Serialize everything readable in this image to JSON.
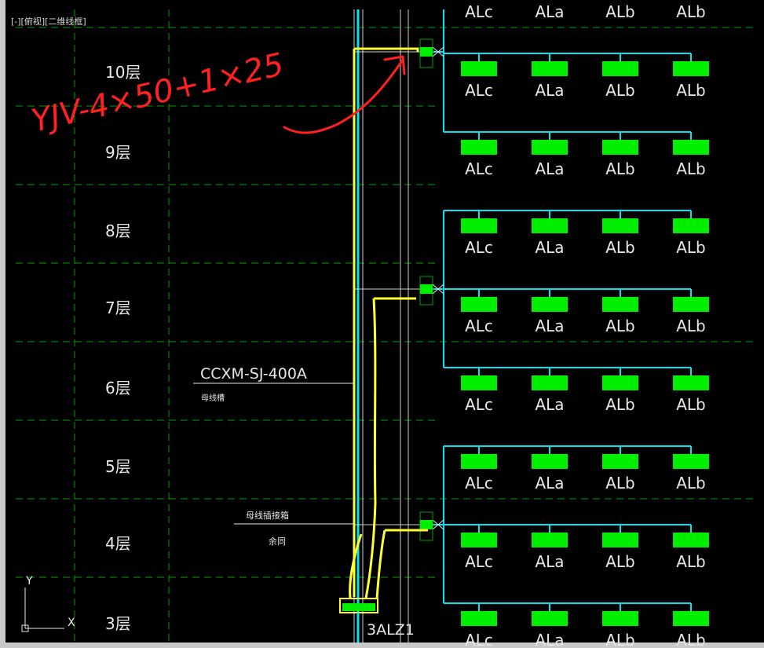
{
  "viewport_label": "[-][俯视][二维线框]",
  "floors": [
    {
      "label": "10层"
    },
    {
      "label": "9层"
    },
    {
      "label": "8层"
    },
    {
      "label": "7层"
    },
    {
      "label": "6层"
    },
    {
      "label": "5层"
    },
    {
      "label": "4层"
    },
    {
      "label": "3层"
    }
  ],
  "panel_labels": [
    "ALc",
    "ALa",
    "ALb",
    "ALb"
  ],
  "busway": {
    "model": "CCXM-SJ-400A",
    "caption": "母线槽"
  },
  "plugin_box": {
    "label": "母线插接箱",
    "note": "余同"
  },
  "main_panel": {
    "label": "3ALZ1"
  },
  "annotation": {
    "text": "YJV-4×50+1×25",
    "color": "#ff2020"
  },
  "ucs": {
    "y_label": "Y",
    "x_label": "X"
  },
  "colors": {
    "background": "#000000",
    "grid": "#00a000",
    "riser": "#00e5ee",
    "panel": "#00ee00",
    "text": "#e8e8e8",
    "highlight": "#ffff33"
  }
}
